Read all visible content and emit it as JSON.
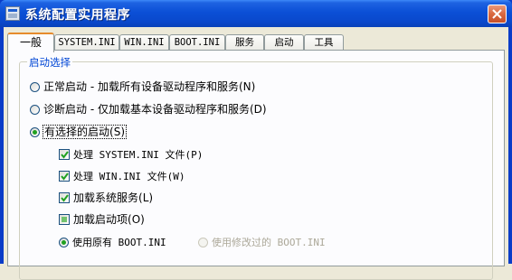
{
  "window": {
    "title": "系统配置实用程序"
  },
  "tabs": [
    {
      "label": "一般",
      "active": true
    },
    {
      "label": "SYSTEM.INI",
      "active": false
    },
    {
      "label": "WIN.INI",
      "active": false
    },
    {
      "label": "BOOT.INI",
      "active": false
    },
    {
      "label": "服务",
      "active": false
    },
    {
      "label": "启动",
      "active": false
    },
    {
      "label": "工具",
      "active": false
    }
  ],
  "startup_group": {
    "legend": "启动选择",
    "normal": {
      "label": "正常启动 - 加载所有设备驱动程序和服务",
      "mnemonic": "(N)",
      "selected": false
    },
    "diagnostic": {
      "label": "诊断启动 - 仅加载基本设备驱动程序和服务",
      "mnemonic": "(D)",
      "selected": false
    },
    "selective": {
      "label": "有选择的启动",
      "mnemonic": "(S)",
      "selected": true
    },
    "options": {
      "system_ini": {
        "label": "处理 SYSTEM.INI 文件",
        "mnemonic": "(P)",
        "state": "checked"
      },
      "win_ini": {
        "label": "处理 WIN.INI 文件",
        "mnemonic": "(W)",
        "state": "checked"
      },
      "services": {
        "label": "加载系统服务",
        "mnemonic": "(L)",
        "state": "checked"
      },
      "startup_items": {
        "label": "加载启动项",
        "mnemonic": "(O)",
        "state": "indeterminate"
      }
    },
    "boot_ini": {
      "original": {
        "label": "使用原有 BOOT.INI",
        "selected": true
      },
      "modified": {
        "label": "使用修改过的 BOOT.INI",
        "selected": false,
        "disabled": true
      }
    }
  },
  "colors": {
    "titlebar": "#0A48CC",
    "group_legend": "#0046D5",
    "checkmark": "#21A121",
    "active_tab_accent": "#E68B2C"
  },
  "icons": [
    "app-icon",
    "close-icon",
    "checkmark-icon"
  ]
}
